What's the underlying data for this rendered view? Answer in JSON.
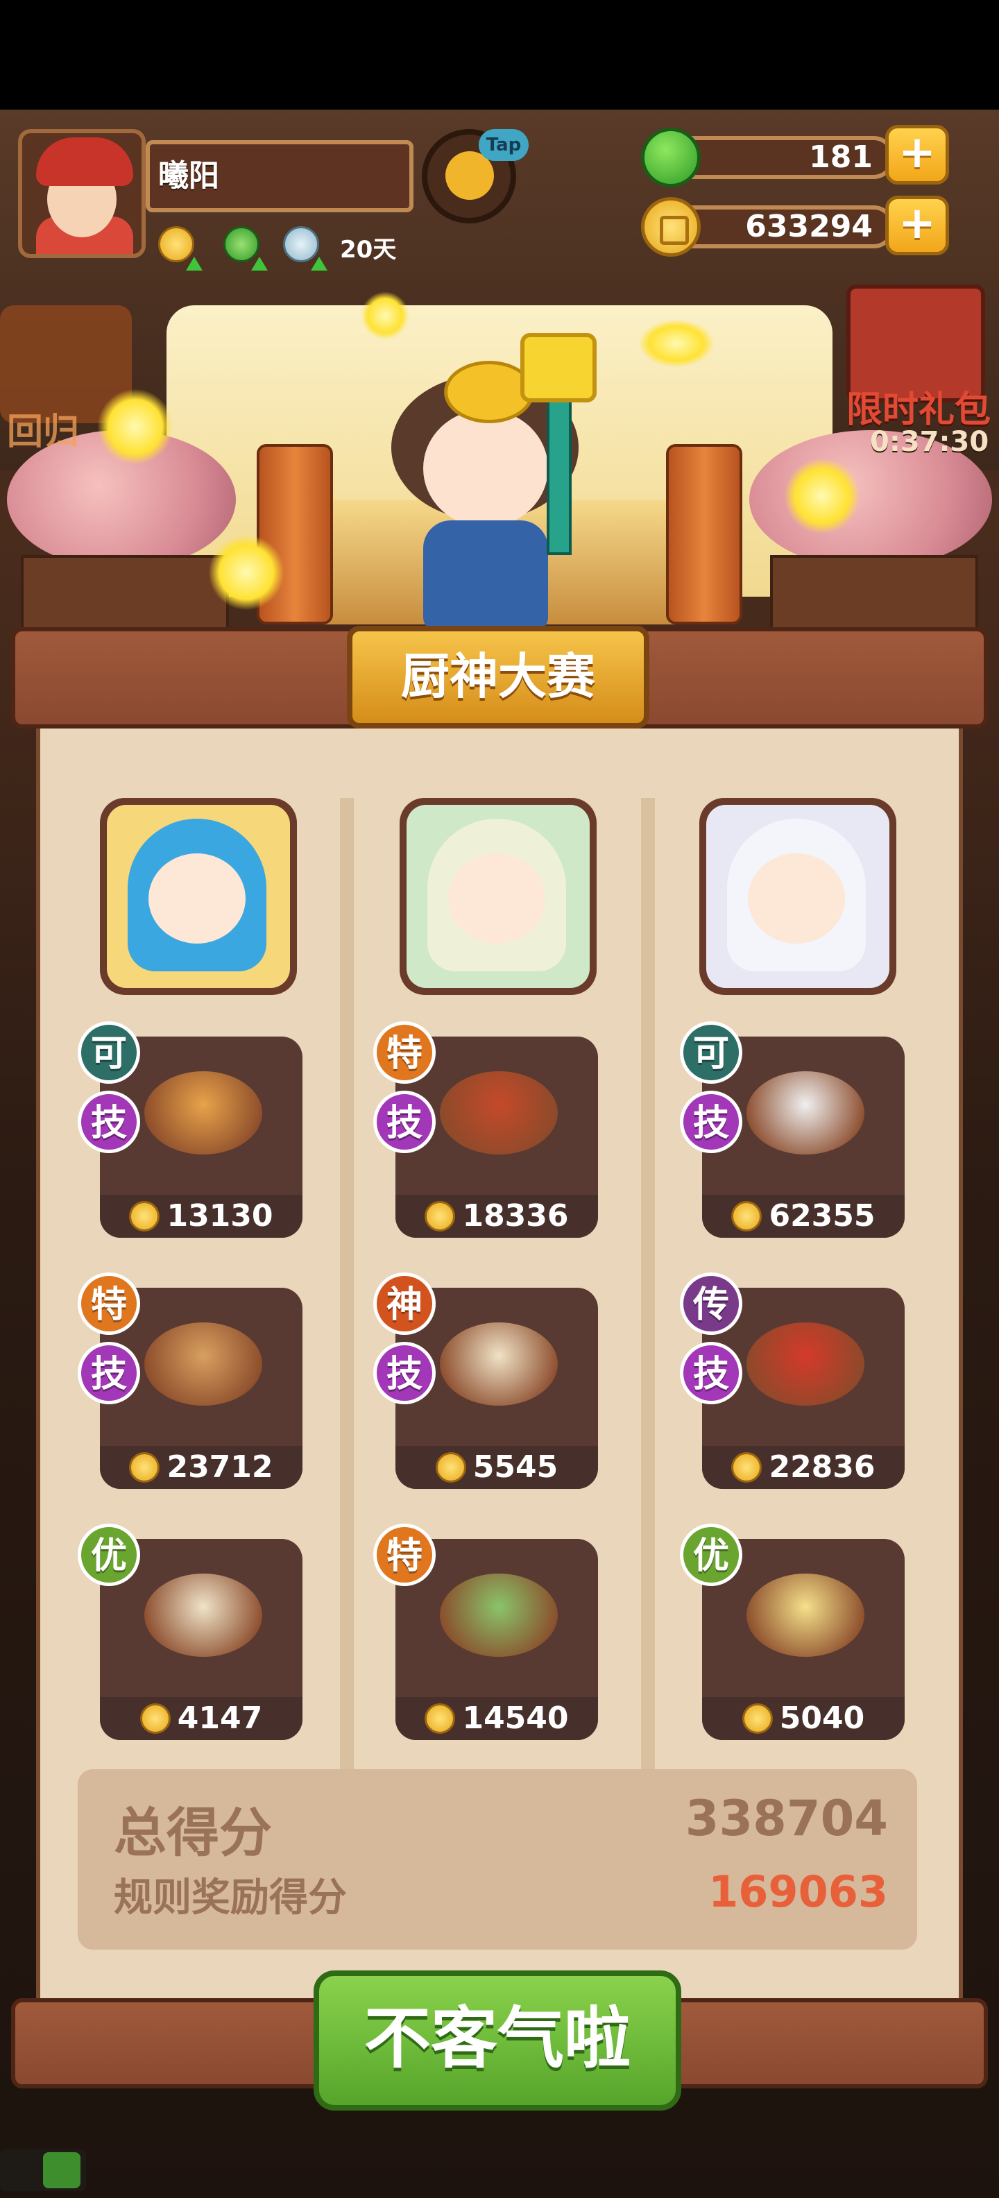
{
  "player": {
    "name": "曦阳",
    "buff_days": "20天"
  },
  "header": {
    "tap_label": "Tap",
    "gems": "181",
    "coins": "633294",
    "plus_symbol": "+"
  },
  "side": {
    "left_badge_text": "回归",
    "gift_text": "限时礼包",
    "gift_timer": "0:37:30"
  },
  "contest": {
    "title": "厨神大赛",
    "chefs": [
      {
        "name": "chef-1",
        "dishes": [
          {
            "grade": "可",
            "grade_class": "b-ke",
            "skill": "技",
            "price": "13130",
            "food_color": "#e8a34a"
          },
          {
            "grade": "特",
            "grade_class": "b-te",
            "skill": "技",
            "price": "23712",
            "food_color": "#d8a060"
          },
          {
            "grade": "优",
            "grade_class": "b-you",
            "skill": "",
            "price": "4147",
            "food_color": "#efe3c8"
          }
        ]
      },
      {
        "name": "chef-2",
        "dishes": [
          {
            "grade": "特",
            "grade_class": "b-te",
            "skill": "技",
            "price": "18336",
            "food_color": "#c44a2a"
          },
          {
            "grade": "神",
            "grade_class": "b-shen",
            "skill": "技",
            "price": "5545",
            "food_color": "#f0e2c6"
          },
          {
            "grade": "特",
            "grade_class": "b-te",
            "skill": "",
            "price": "14540",
            "food_color": "#8ac46a"
          }
        ]
      },
      {
        "name": "chef-3",
        "dishes": [
          {
            "grade": "可",
            "grade_class": "b-ke",
            "skill": "技",
            "price": "62355",
            "food_color": "#f0f0f0"
          },
          {
            "grade": "传",
            "grade_class": "b-chuan",
            "skill": "技",
            "price": "22836",
            "food_color": "#d43a2a"
          },
          {
            "grade": "优",
            "grade_class": "b-you",
            "skill": "",
            "price": "5040",
            "food_color": "#f4e08a"
          }
        ]
      }
    ],
    "total_score_label": "总得分",
    "total_score": "338704",
    "bonus_label": "规则奖励得分",
    "bonus_score": "169063"
  },
  "actions": {
    "confirm_label": "不客气啦"
  },
  "colors": {
    "bonus_accent": "#e7603a",
    "button_green": "#6dbb38",
    "plaque_gold": "#f2b53a"
  }
}
